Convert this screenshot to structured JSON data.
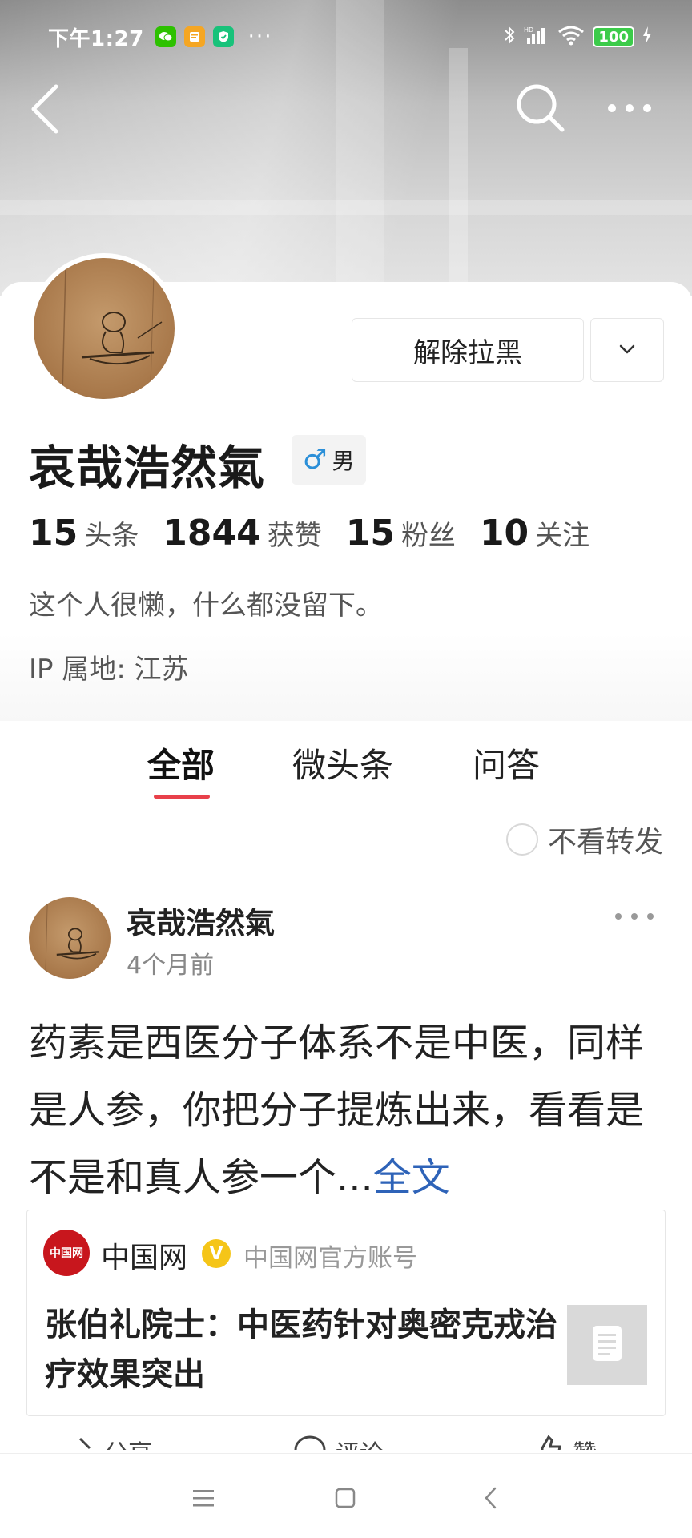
{
  "status_bar": {
    "time": "下午1:27",
    "battery": "100",
    "more": "···"
  },
  "profile": {
    "unblock_label": "解除拉黑",
    "name": "哀哉浩然氣",
    "gender_symbol": "♂",
    "gender": "男",
    "stats": [
      {
        "num": "15",
        "label": "头条"
      },
      {
        "num": "1844",
        "label": "获赞"
      },
      {
        "num": "15",
        "label": "粉丝"
      },
      {
        "num": "10",
        "label": "关注"
      }
    ],
    "bio": "这个人很懒，什么都没留下。",
    "ip": "IP 属地: 江苏"
  },
  "tabs": [
    {
      "label": "全部",
      "active": true
    },
    {
      "label": "微头条",
      "active": false
    },
    {
      "label": "问答",
      "active": false
    }
  ],
  "filter": {
    "label": "不看转发",
    "checked": false
  },
  "post": {
    "author": "哀哉浩然氣",
    "time": "4个月前",
    "text": "药素是西医分子体系不是中医，同样是人参，你把分子提炼出来，看看是不是和真人参一个...",
    "fulltext_link": "全文",
    "share": {
      "logo_text": "中国网",
      "source": "中国网",
      "verified": "V",
      "source_sub": "中国网官方账号",
      "title": "张伯礼院士：中医药针对奥密克戎治疗效果突出"
    },
    "actions": [
      "分享",
      "评论",
      "赞"
    ]
  },
  "colors": {
    "accent_red": "#e8404a",
    "link_blue": "#2e63b8",
    "brand_red": "#c8161d",
    "verified_yellow": "#f5c518"
  }
}
